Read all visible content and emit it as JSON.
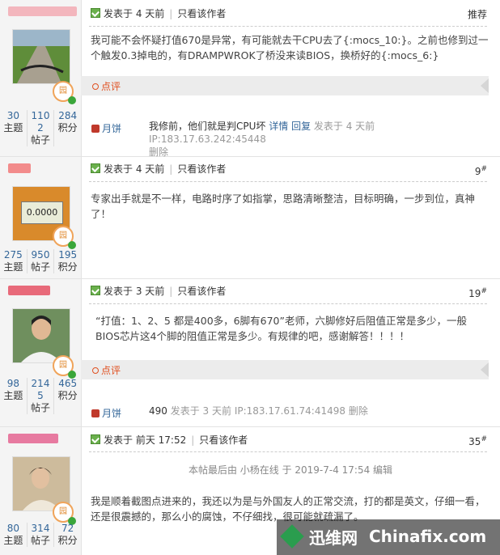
{
  "posts": [
    {
      "username_color": "#f3b6bd",
      "meta": {
        "posted": "发表于 4 天前",
        "only_author": "只看该作者",
        "floor": "推荐",
        "floor_sup": ""
      },
      "content": "我可能不会怀疑打值670是异常，有可能就去干CPU去了{:mocs_10:}。之前也修到过一个触发0.3掉电的，有DRAMPWROK了桥没来读BIOS，换桥好的{:mocs_6:}",
      "avatar_icon": "road-photo-avatar",
      "badge": "园",
      "stats": [
        {
          "n": "30",
          "l": "主题"
        },
        {
          "n": "1102",
          "l": "帖子"
        },
        {
          "n": "284",
          "l": "积分"
        }
      ],
      "comment_label": "点评",
      "comment": {
        "user": "月饼",
        "text": "我修前，他们就是判CPU坏",
        "detail": "详情",
        "reply": "回复",
        "time": "发表于 4 天前 IP:183.17.63.242:45448",
        "delete": "删除"
      }
    },
    {
      "username_color": "#f28b8b",
      "meta": {
        "posted": "发表于 4 天前",
        "only_author": "只看该作者",
        "floor": "9",
        "floor_sup": "#"
      },
      "content": "专家出手就是不一样，电路时序了如指掌，思路清晰整洁，目标明确，一步到位，真神了！",
      "avatar_icon": "multimeter-avatar",
      "avatar_text": "0.0000",
      "badge": "园",
      "stats": [
        {
          "n": "275",
          "l": "主题"
        },
        {
          "n": "950",
          "l": "帖子"
        },
        {
          "n": "195",
          "l": "积分"
        }
      ]
    },
    {
      "username_color": "#e86a7a",
      "meta": {
        "posted": "发表于 3 天前",
        "only_author": "只看该作者",
        "floor": "19",
        "floor_sup": "#"
      },
      "content": "“打值：1、2、5 都是400多，6脚有670”老师，六脚修好后阻值正常是多少，一般BIOS芯片这4个脚的阻值正常是多少。有规律的吧，感谢解答！！！！",
      "avatar_icon": "man-photo-avatar",
      "badge": "园",
      "stats": [
        {
          "n": "98",
          "l": "主题"
        },
        {
          "n": "2145",
          "l": "帖子"
        },
        {
          "n": "465",
          "l": "积分"
        }
      ],
      "comment_label": "点评",
      "comment": {
        "user": "月饼",
        "text": "490",
        "time": "发表于 3 天前 IP:183.17.61.74:41498",
        "delete": "删除"
      }
    },
    {
      "username_color": "#e77aa0",
      "meta": {
        "posted": "发表于 前天 17:52",
        "only_author": "只看该作者",
        "floor": "35",
        "floor_sup": "#"
      },
      "edit_note": "本帖最后由 小杨在线 于 2019-7-4 17:54 编辑",
      "content": "我是顺着截图点进来的，我还以为是与外国友人的正常交流，打的都是英文，仔细一看，还是很震撼的，那么小的腐蚀，不仔细找，很可能就疏漏了。",
      "avatar_icon": "young-man-photo-avatar",
      "badge": "园",
      "stats": [
        {
          "n": "80",
          "l": "主题"
        },
        {
          "n": "314",
          "l": "帖子"
        },
        {
          "n": "72",
          "l": "积分"
        }
      ]
    }
  ],
  "watermark": {
    "brand_cn": "迅维网",
    "brand_en": "Chinafix.com"
  }
}
